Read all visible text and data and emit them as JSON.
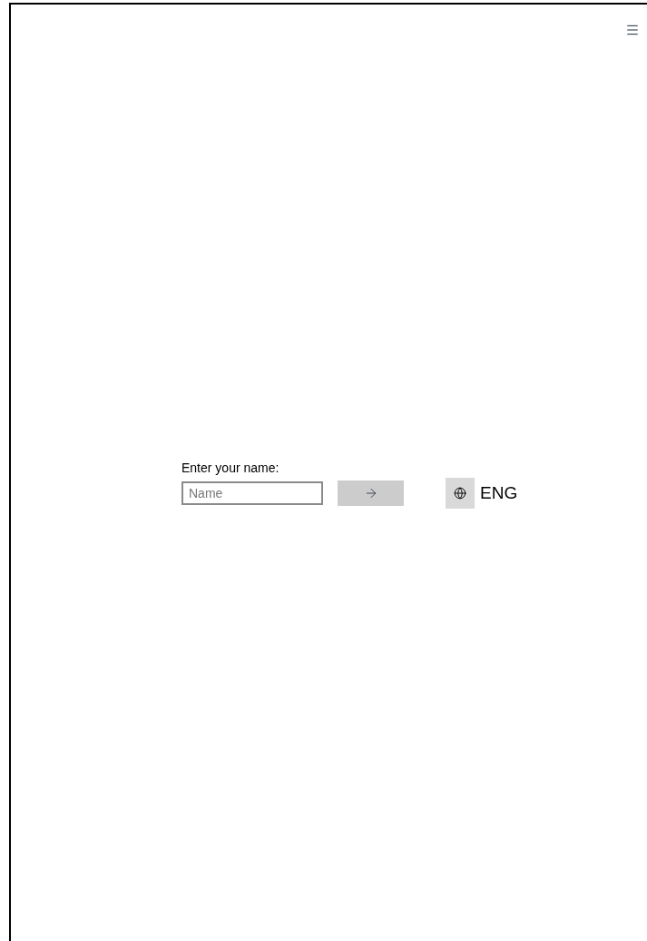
{
  "prompt": {
    "label": "Enter your name:",
    "placeholder": "Name"
  },
  "language": {
    "label": "ENG"
  }
}
